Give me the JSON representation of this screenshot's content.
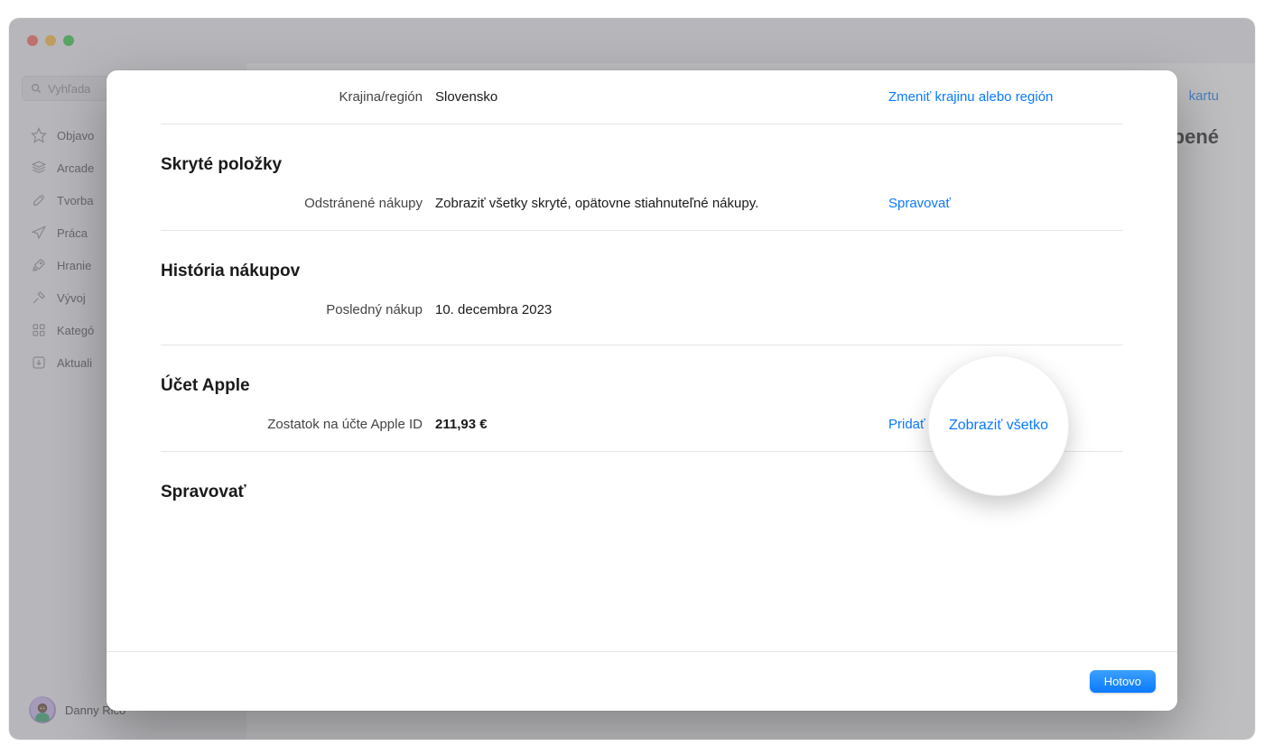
{
  "sidebar": {
    "search_placeholder": "Vyhľada",
    "items": [
      {
        "label": "Objavo",
        "icon": "star"
      },
      {
        "label": "Arcade",
        "icon": "arcade"
      },
      {
        "label": "Tvorba",
        "icon": "brush"
      },
      {
        "label": "Práca",
        "icon": "plane"
      },
      {
        "label": "Hranie",
        "icon": "rocket"
      },
      {
        "label": "Vývoj",
        "icon": "hammer"
      },
      {
        "label": "Kategó",
        "icon": "grid"
      },
      {
        "label": "Aktuali",
        "icon": "download"
      }
    ]
  },
  "profile": {
    "name": "Danny Rico"
  },
  "background_content": {
    "right_link_partial": "kartu",
    "heading_partial": "upené"
  },
  "modal": {
    "country_region": {
      "label": "Krajina/región",
      "value": "Slovensko",
      "action": "Zmeniť krajinu alebo región"
    },
    "hidden_items": {
      "title": "Skryté položky",
      "row_label": "Odstránené nákupy",
      "row_value": "Zobraziť všetky skryté, opätovne stiahnuteľné nákupy.",
      "action": "Spravovať"
    },
    "purchase_history": {
      "title": "História nákupov",
      "row_label": "Posledný nákup",
      "row_value": "10. decembra 2023",
      "action": "Zobraziť všetko"
    },
    "apple_account": {
      "title": "Účet Apple",
      "row_label": "Zostatok na účte Apple ID",
      "row_value": "211,93 €",
      "action": "Pridať peniaze"
    },
    "manage": {
      "title": "Spravovať"
    },
    "done_button": "Hotovo"
  },
  "colors": {
    "accent": "#0a7aff"
  }
}
